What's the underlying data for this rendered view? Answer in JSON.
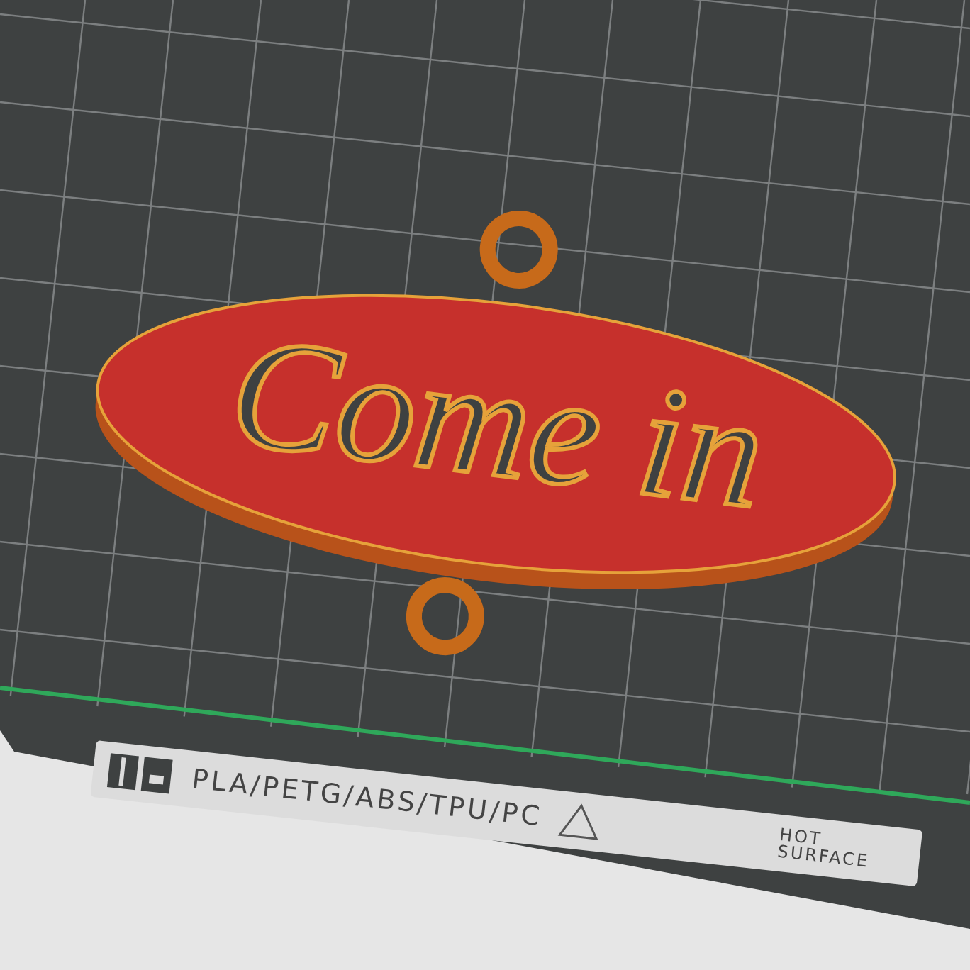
{
  "viewport": {
    "model": {
      "text": "Come in"
    },
    "bed_label": {
      "materials": "PLA/PETG/ABS/TPU/PC",
      "warning": "HOT SURFACE"
    }
  }
}
